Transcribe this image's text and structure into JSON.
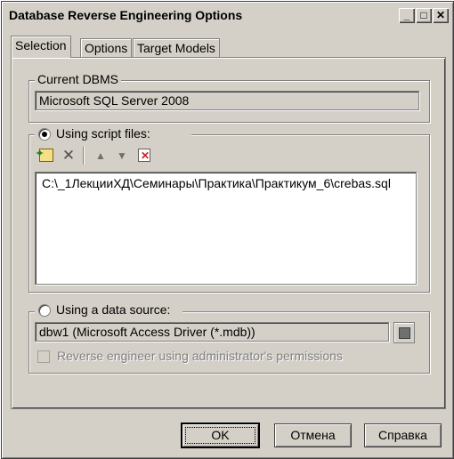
{
  "window": {
    "title": "Database Reverse Engineering Options",
    "minimize": "_",
    "maximize": "□",
    "close": "✕"
  },
  "tabs": [
    {
      "label": "Selection",
      "active": true
    },
    {
      "label": "Options",
      "active": false
    },
    {
      "label": "Target Models",
      "active": false
    }
  ],
  "current_dbms": {
    "legend": "Current DBMS",
    "value": "Microsoft SQL Server 2008"
  },
  "script_files": {
    "radio_label": "Using script files:",
    "selected": true,
    "toolbar_icons": [
      "add-files-icon",
      "delete-icon",
      "move-up-icon",
      "move-down-icon",
      "clear-list-icon"
    ],
    "files": [
      "C:\\_1ЛекцииХД\\Семинары\\Практика\\Практикум_6\\crebas.sql"
    ]
  },
  "data_source": {
    "radio_label": "Using a data source:",
    "selected": false,
    "value": "dbw1 (Microsoft Access Driver (*.mdb))",
    "admin_checkbox_label": "Reverse engineer using administrator's permissions",
    "admin_checked": false
  },
  "buttons": {
    "ok": "OK",
    "cancel": "Отмена",
    "help": "Справка"
  }
}
